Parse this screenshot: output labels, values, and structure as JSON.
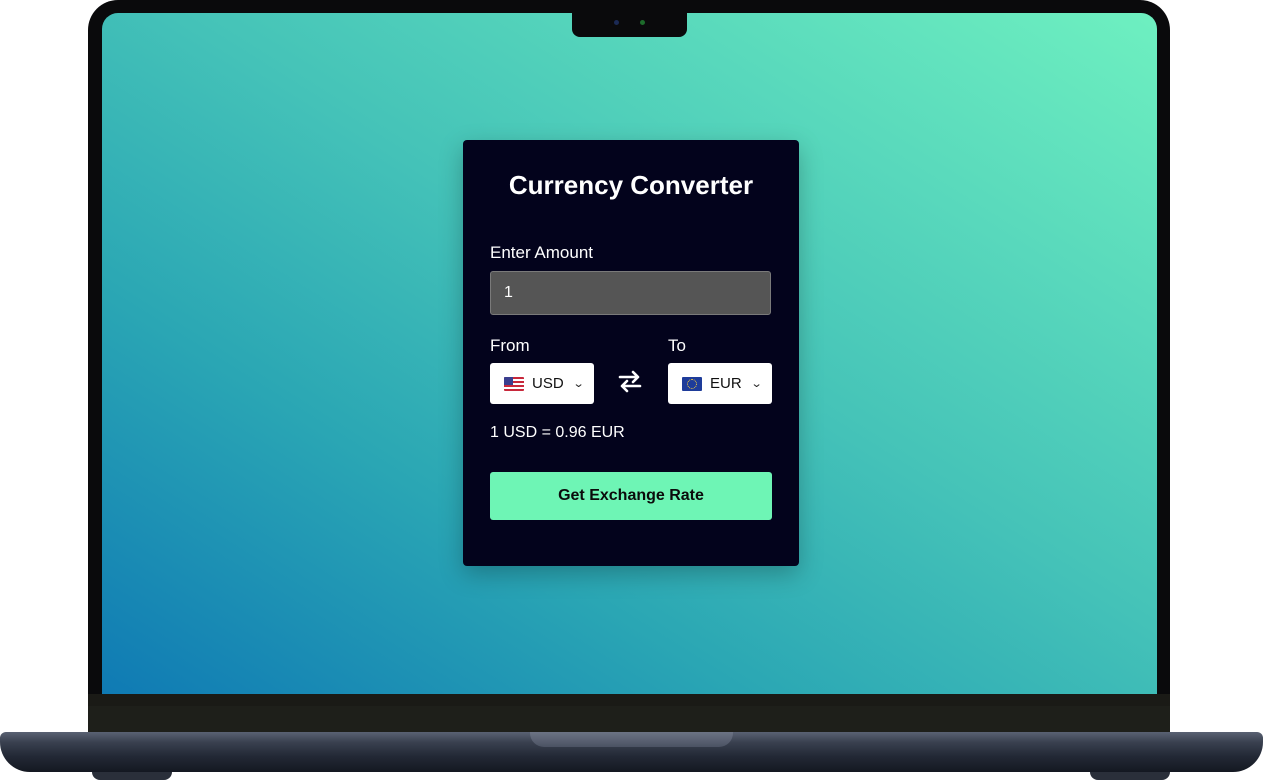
{
  "converter": {
    "title": "Currency Converter",
    "amount_label": "Enter Amount",
    "amount_value": "1",
    "from_label": "From",
    "to_label": "To",
    "from_currency": "USD",
    "to_currency": "EUR",
    "from_flag": "us-flag-icon",
    "to_flag": "eu-flag-icon",
    "swap_icon": "swap-arrows-icon",
    "rate_text": "1 USD = 0.96 EUR",
    "button_label": "Get Exchange Rate"
  },
  "colors": {
    "card_bg": "#03031c",
    "button_bg": "#6ef5b5",
    "input_bg": "#555555",
    "gradient_start": "#0f7ab4",
    "gradient_end": "#6ef0c0"
  }
}
